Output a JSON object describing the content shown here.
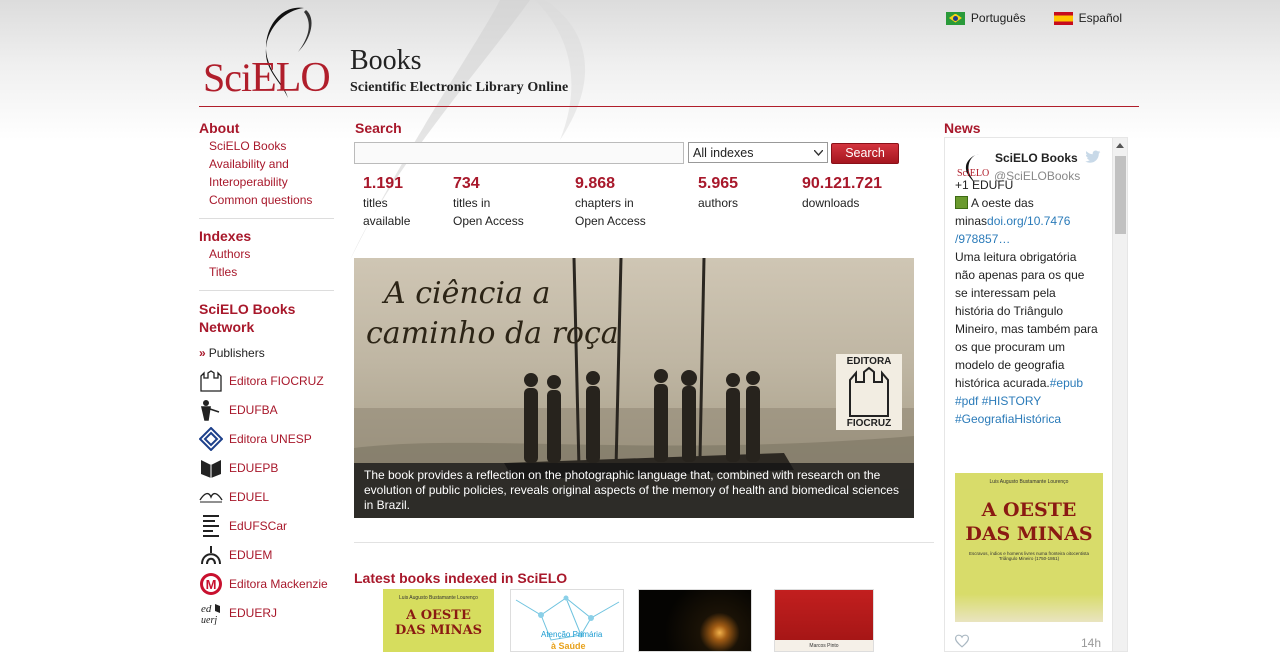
{
  "lang": {
    "portuguese": "Português",
    "spanish": "Español"
  },
  "header": {
    "logo_sci": "Sci",
    "logo_elo": "ELO",
    "title": "Books",
    "subtitle": "Scientific Electronic Library Online"
  },
  "sidebar": {
    "about_title": "About",
    "about_links": [
      "SciELO Books",
      "Availability and",
      "Interoperability",
      "Common questions"
    ],
    "indexes_title": "Indexes",
    "indexes_links": [
      "Authors",
      "Titles"
    ],
    "network_title_1": "SciELO Books",
    "network_title_2": "Network",
    "publishers_label": "Publishers",
    "publishers": [
      {
        "label": "Editora FIOCRUZ",
        "icon": "fiocruz-icon"
      },
      {
        "label": "EDUFBA",
        "icon": "edufba-icon"
      },
      {
        "label": "Editora UNESP",
        "icon": "unesp-icon"
      },
      {
        "label": "EDUEPB",
        "icon": "eduepb-icon"
      },
      {
        "label": "EDUEL",
        "icon": "eduel-icon"
      },
      {
        "label": "EdUFSCar",
        "icon": "edufscar-icon"
      },
      {
        "label": "EDUEM",
        "icon": "eduem-icon"
      },
      {
        "label": "Editora Mackenzie",
        "icon": "mackenzie-icon"
      },
      {
        "label": "EDUERJ",
        "icon": "eduerj-icon"
      }
    ]
  },
  "search": {
    "label": "Search",
    "input_value": "",
    "index_selected": "All indexes",
    "button": "Search"
  },
  "stats": [
    {
      "value": "1.191",
      "line1": "titles",
      "line2": "available"
    },
    {
      "value": "734",
      "line1": "titles in",
      "line2": "Open Access"
    },
    {
      "value": "9.868",
      "line1": "chapters in",
      "line2": "Open Access"
    },
    {
      "value": "5.965",
      "line1": "authors",
      "line2": ""
    },
    {
      "value": "90.121.721",
      "line1": "downloads",
      "line2": ""
    }
  ],
  "feature": {
    "title_line1": "A ciência a",
    "title_line2": "caminho da roça",
    "badge_top": "EDITORA",
    "badge_bottom": "FIOCRUZ",
    "caption": "The book provides a reflection on the photographic language that, combined with research on the evolution of public policies, reveals original aspects of the memory of health and biomedical sciences in Brazil."
  },
  "latest": {
    "label": "Latest books indexed in  SciELO",
    "books": [
      {
        "author": "Luis Augusto Bustamante Lourenço",
        "title_line1": "A OESTE",
        "title_line2": "DAS MINAS"
      },
      {
        "title_line1": "Atenção Primária",
        "title_line2": "à Saúde"
      },
      {},
      {
        "footer": "Marcos Pinto"
      }
    ]
  },
  "news": {
    "label": "News",
    "name": "SciELO Books",
    "handle": "@SciELOBooks",
    "body": {
      "l1": "+1 EDUFU",
      "l2": "A oeste das",
      "l3a": "minas",
      "l3b": "doi.org/10.7476",
      "l4": "/978857…",
      "l5": "Uma leitura obrigatória",
      "l6": "não apenas para os que",
      "l7": "se interessam pela",
      "l8": "história do Triângulo",
      "l9": "Mineiro, mas também para",
      "l10": "os que procuram um",
      "l11": "modelo de geografia",
      "l12a": "histórica acurada.",
      "l12b": "#epub",
      "l13": "#pdf #HISTORY",
      "l14": "#GeografiaHistórica"
    },
    "image": {
      "author": "Luis Augusto Bustamante Lourenço",
      "title_line1": "A OESTE",
      "title_line2": "DAS MINAS",
      "subtitle": "Escravos, índios e homens livres numa fronteira oitocentista Triângulo Mineiro (1750-1861)"
    },
    "time": "14h"
  },
  "colors": {
    "brand_red": "#a8182b",
    "link_blue": "#2b7bb9"
  }
}
